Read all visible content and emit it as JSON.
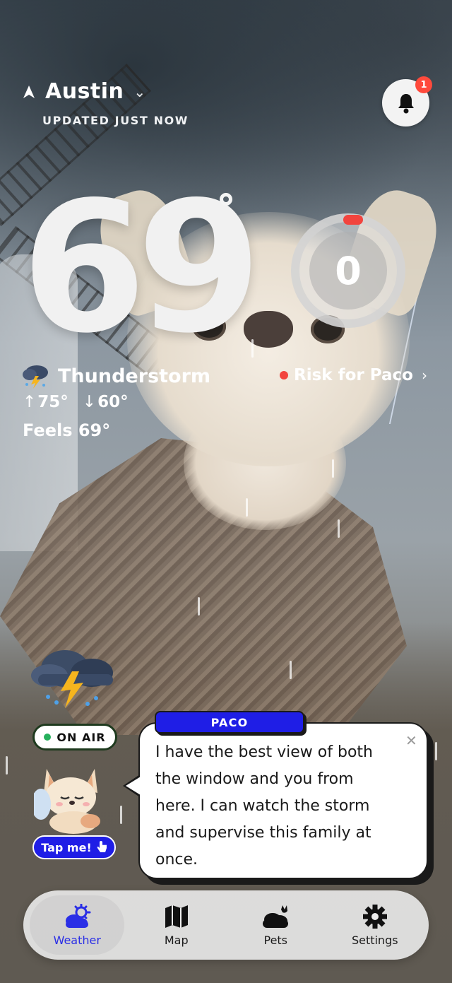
{
  "location": {
    "city": "Austin",
    "updated": "UPDATED JUST NOW"
  },
  "notifications": {
    "badge_count": "1"
  },
  "weather": {
    "temperature": "69",
    "condition": "Thunderstorm",
    "high": "75°",
    "low": "60°",
    "feels_like": "Feels 69°"
  },
  "risk": {
    "value": "0",
    "label": "Risk for Paco"
  },
  "radio": {
    "status": "ON AIR",
    "tap_label": "Tap me!"
  },
  "speech": {
    "speaker": "PACO",
    "message": "I have the best view of both the window and you from here. I can watch the storm and supervise this family at once."
  },
  "tabs": [
    {
      "label": "Weather",
      "icon": "weather-icon",
      "active": true
    },
    {
      "label": "Map",
      "icon": "map-icon",
      "active": false
    },
    {
      "label": "Pets",
      "icon": "pets-icon",
      "active": false
    },
    {
      "label": "Settings",
      "icon": "settings-icon",
      "active": false
    }
  ],
  "colors": {
    "accent": "#2a2ee6",
    "alert": "#f2443e",
    "on_air": "#26b05c"
  }
}
